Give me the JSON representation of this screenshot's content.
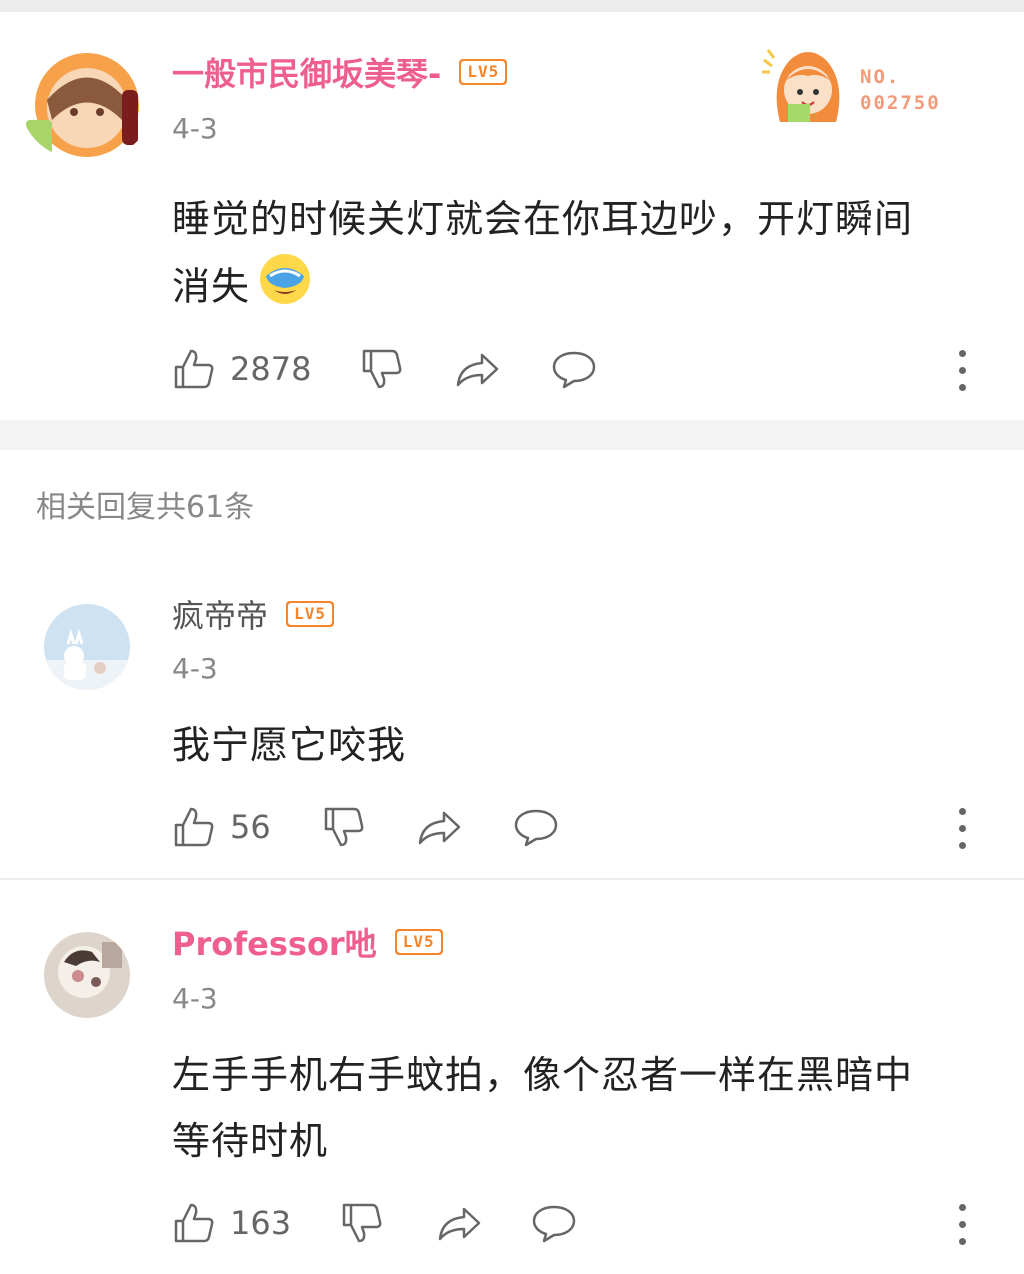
{
  "comments": [
    {
      "username": "一般市民御坂美琴-",
      "level": "LV5",
      "date": "4-3",
      "text_lines": [
        "睡觉的时候关灯就会在你耳边吵，开灯瞬间",
        "消失"
      ],
      "emoji": "laughing-tears-emoji",
      "likes": "2878",
      "badge": {
        "line1": "NO.",
        "line2": "002750"
      }
    },
    {
      "username": "疯帝帝",
      "level": "LV5",
      "date": "4-3",
      "text_lines": [
        "我宁愿它咬我"
      ],
      "likes": "56"
    },
    {
      "username": "Professor吔",
      "level": "LV5",
      "date": "4-3",
      "text_lines": [
        "左手手机右手蚊拍，像个忍者一样在黑暗中",
        "等待时机"
      ],
      "likes": "163"
    }
  ],
  "replies_header": "相关回复共61条",
  "icons": {
    "like": "thumbs-up-icon",
    "dislike": "thumbs-down-icon",
    "share": "share-icon",
    "reply": "comment-bubble-icon",
    "more": "more-vertical-icon"
  },
  "colors": {
    "username_pink": "#ee5f8f",
    "level_orange": "#f5852b",
    "meta_gray": "#888888"
  }
}
